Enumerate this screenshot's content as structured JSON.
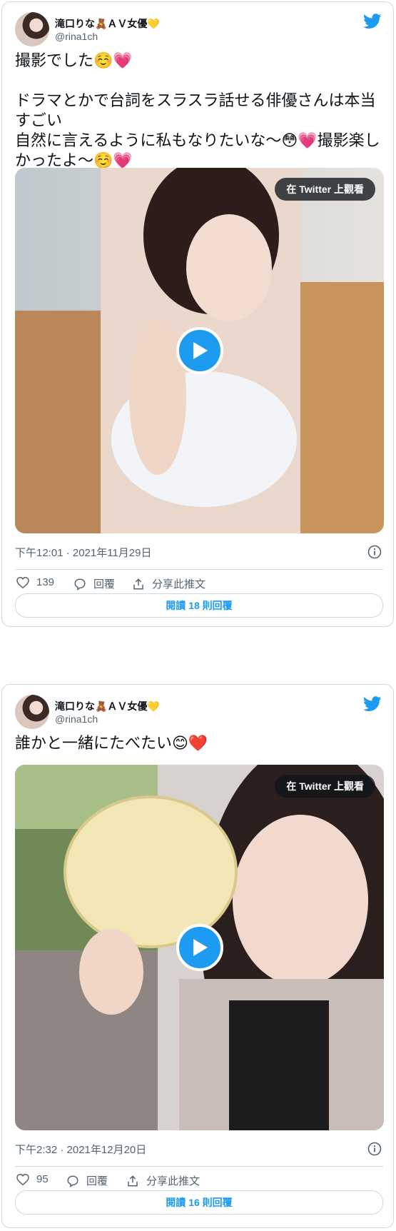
{
  "tweets": [
    {
      "author_name": "滝口りな🧸ＡＶ女優💛",
      "author_handle": "@rina1ch",
      "text": "撮影でした☺️💗\n\nドラマとかで台詞をスラスラ話せる俳優さんは本当すごい\n自然に言えるように私もなりたいな〜😳💗撮影楽しかったよ〜☺️💗",
      "media_button": "在 Twitter 上觀看",
      "timestamp": "下午12:01 · 2021年11月29日",
      "likes": "139",
      "reply_label": "回覆",
      "share_label": "分享此推文",
      "read_replies": "閱讀 18 則回覆"
    },
    {
      "author_name": "滝口りな🧸ＡＶ女優💛",
      "author_handle": "@rina1ch",
      "text": "誰かと一緒にたべたい😊❤️",
      "media_button": "在 Twitter 上觀看",
      "timestamp": "下午2:32 · 2021年12月20日",
      "likes": "95",
      "reply_label": "回覆",
      "share_label": "分享此推文",
      "read_replies": "閱讀 16 則回覆"
    }
  ],
  "icons": {
    "brand": "twitter-bird-icon",
    "play": "play-icon",
    "info": "info-icon",
    "like": "heart-icon",
    "reply": "speech-bubble-icon",
    "share": "share-icon"
  },
  "colors": {
    "accent": "#1d9bf0",
    "border": "#cfd9de",
    "secondary_text": "#536471"
  }
}
